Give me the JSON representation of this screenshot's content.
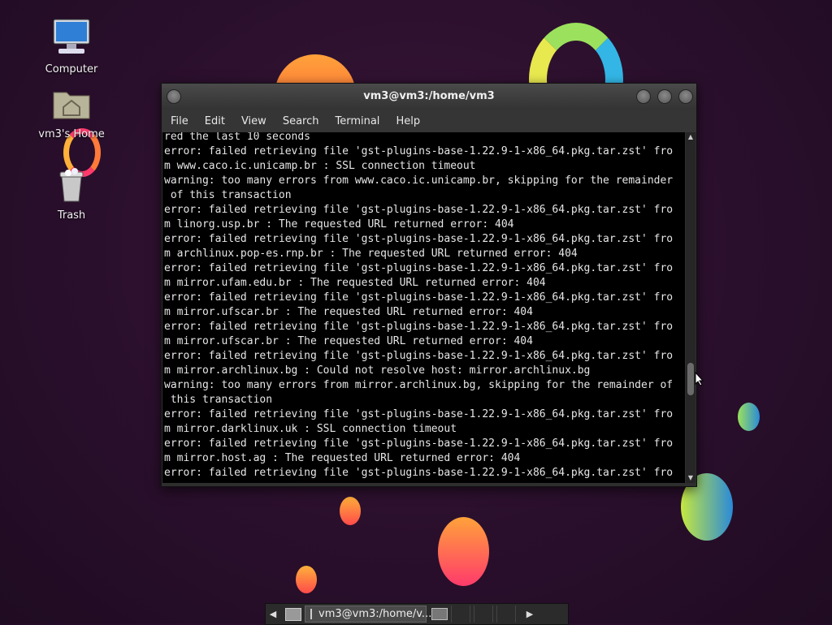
{
  "desktop": {
    "icons": [
      {
        "label": "Computer"
      },
      {
        "label": "vm3's Home"
      },
      {
        "label": "Trash"
      }
    ]
  },
  "window": {
    "title": "vm3@vm3:/home/vm3",
    "menu": [
      "File",
      "Edit",
      "View",
      "Search",
      "Terminal",
      "Help"
    ],
    "terminal_text": "red the last 10 seconds\nerror: failed retrieving file 'gst-plugins-base-1.22.9-1-x86_64.pkg.tar.zst' fro\nm www.caco.ic.unicamp.br : SSL connection timeout\nwarning: too many errors from www.caco.ic.unicamp.br, skipping for the remainder\n of this transaction\nerror: failed retrieving file 'gst-plugins-base-1.22.9-1-x86_64.pkg.tar.zst' fro\nm linorg.usp.br : The requested URL returned error: 404\nerror: failed retrieving file 'gst-plugins-base-1.22.9-1-x86_64.pkg.tar.zst' fro\nm archlinux.pop-es.rnp.br : The requested URL returned error: 404\nerror: failed retrieving file 'gst-plugins-base-1.22.9-1-x86_64.pkg.tar.zst' fro\nm mirror.ufam.edu.br : The requested URL returned error: 404\nerror: failed retrieving file 'gst-plugins-base-1.22.9-1-x86_64.pkg.tar.zst' fro\nm mirror.ufscar.br : The requested URL returned error: 404\nerror: failed retrieving file 'gst-plugins-base-1.22.9-1-x86_64.pkg.tar.zst' fro\nm mirror.ufscar.br : The requested URL returned error: 404\nerror: failed retrieving file 'gst-plugins-base-1.22.9-1-x86_64.pkg.tar.zst' fro\nm mirror.archlinux.bg : Could not resolve host: mirror.archlinux.bg\nwarning: too many errors from mirror.archlinux.bg, skipping for the remainder of\n this transaction\nerror: failed retrieving file 'gst-plugins-base-1.22.9-1-x86_64.pkg.tar.zst' fro\nm mirror.darklinux.uk : SSL connection timeout\nerror: failed retrieving file 'gst-plugins-base-1.22.9-1-x86_64.pkg.tar.zst' fro\nm mirror.host.ag : The requested URL returned error: 404\nerror: failed retrieving file 'gst-plugins-base-1.22.9-1-x86_64.pkg.tar.zst' fro"
  },
  "taskbar": {
    "task_label": "vm3@vm3:/home/v..."
  },
  "colors": {
    "background": "#2a0f2c",
    "terminal_bg": "#000000",
    "terminal_fg": "#e6e6e6"
  }
}
